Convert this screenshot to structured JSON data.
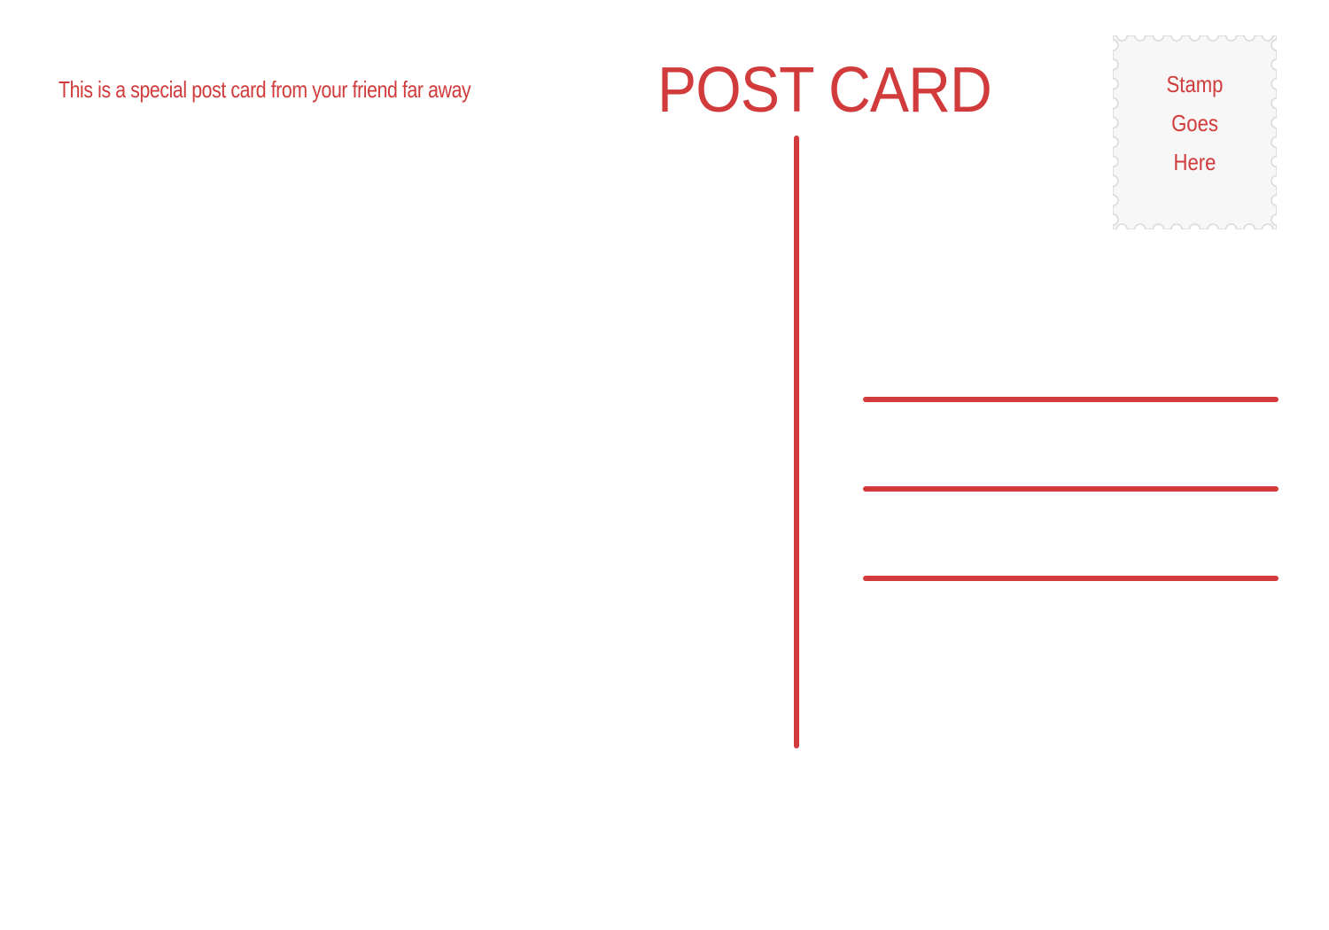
{
  "postcard": {
    "tagline": "This is a special post card from your friend far away",
    "title": "POST CARD",
    "stamp": {
      "line1": "Stamp",
      "line2": "Goes",
      "line3": "Here"
    },
    "address_lines": [
      "",
      "",
      ""
    ]
  },
  "colors": {
    "accent": "#d13b3b",
    "stamp_fill": "#f7f7f7",
    "stamp_edge": "#d9d9d9",
    "background": "#ffffff"
  }
}
